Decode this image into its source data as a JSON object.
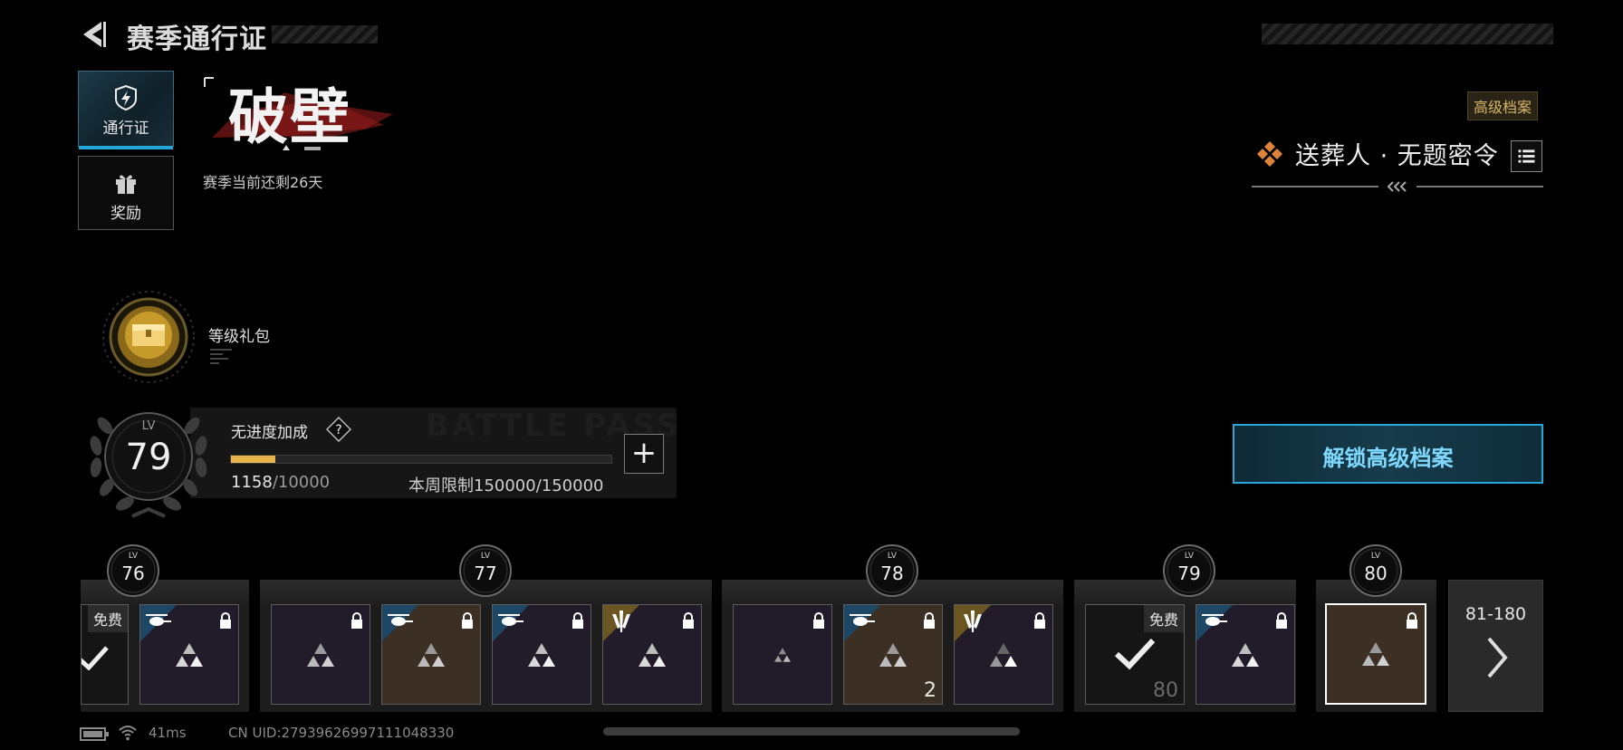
{
  "header": {
    "title": "赛季通行证"
  },
  "tabs": [
    {
      "label": "通行证",
      "icon": "pass-shield-icon",
      "active": true
    },
    {
      "label": "奖励",
      "icon": "gift-box-icon",
      "active": false
    }
  ],
  "season": {
    "logo_text": "破壁",
    "remaining": "赛季当前还剩26天"
  },
  "premium": {
    "badge": "高级档案",
    "pass_name": "送葬人 · 无题密令",
    "unlock_label": "解锁高级档案"
  },
  "gift": {
    "label": "等级礼包"
  },
  "level": {
    "caption": "LV",
    "value": "79",
    "bonus_label": "无进度加成",
    "help_label": "?",
    "xp_current": "1158",
    "xp_max": "/10000",
    "progress_fraction": 0.116,
    "weekly_limit": "本周限制150000/150000",
    "plus_label": "+"
  },
  "watermark": "BATTLE PASS",
  "track": {
    "lv_caption": "LV",
    "levels": [
      "76",
      "77",
      "78",
      "79",
      "80"
    ],
    "free_tag": "免费",
    "qty_78": "2",
    "qty_79_free": "80",
    "next_range": "81-180"
  },
  "status": {
    "ping": "41ms",
    "uid": "CN UID:27939626997111048330"
  },
  "colors": {
    "accent_blue": "#2aa5d8",
    "gold": "#e8b24a",
    "premium_gold": "#d9b76a"
  }
}
